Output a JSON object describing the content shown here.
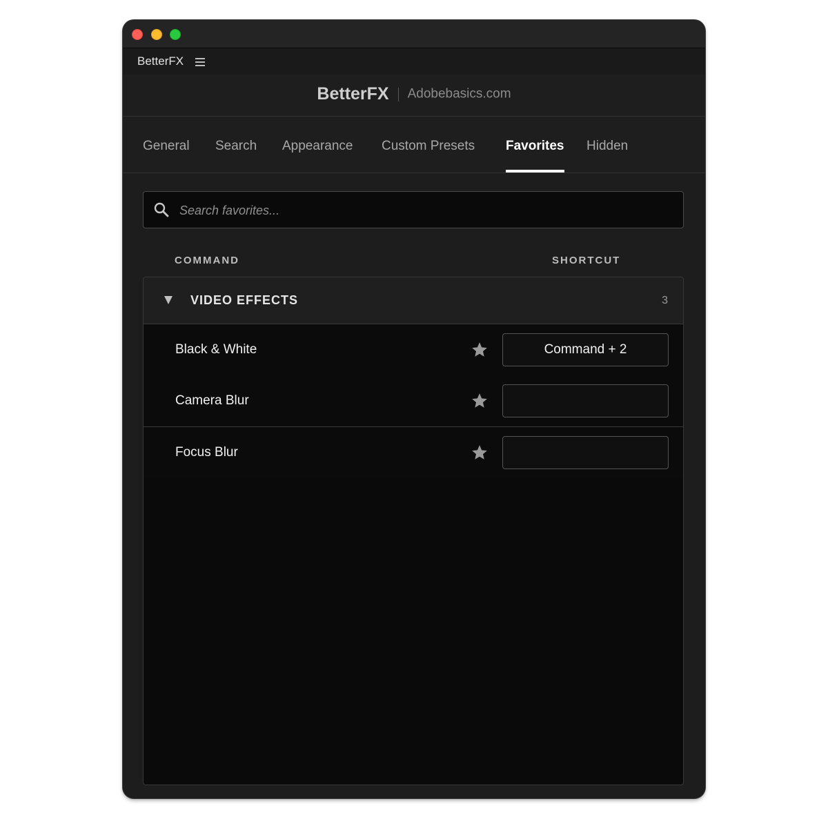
{
  "window": {
    "controls": [
      "close",
      "minimize",
      "maximize"
    ]
  },
  "appbar": {
    "title": "BetterFX",
    "menu_icon": "hamburger-menu-icon"
  },
  "brand": {
    "name": "BetterFX",
    "site": "Adobebasics.com"
  },
  "tabs": [
    {
      "label": "General"
    },
    {
      "label": "Search"
    },
    {
      "label": "Appearance"
    },
    {
      "label": "Custom Presets"
    },
    {
      "label": "Favorites",
      "active": true
    },
    {
      "label": "Hidden"
    }
  ],
  "search": {
    "placeholder": "Search favorites...",
    "value": "",
    "icon": "search-icon"
  },
  "columns": {
    "command": "COMMAND",
    "shortcut": "SHORTCUT"
  },
  "group": {
    "title": "VIDEO EFFECTS",
    "count": "3",
    "expanded": true,
    "icon": "caret-down-icon"
  },
  "items": [
    {
      "name": "Black & White",
      "favorite": true,
      "shortcut": "Command + 2"
    },
    {
      "name": "Camera Blur",
      "favorite": true,
      "shortcut": ""
    },
    {
      "name": "Focus Blur",
      "favorite": true,
      "shortcut": ""
    }
  ],
  "colors": {
    "background": "#1d1d1d",
    "panel": "#0a0a0a",
    "active_tab": "#ffffff",
    "star": "#9a9a9a"
  }
}
